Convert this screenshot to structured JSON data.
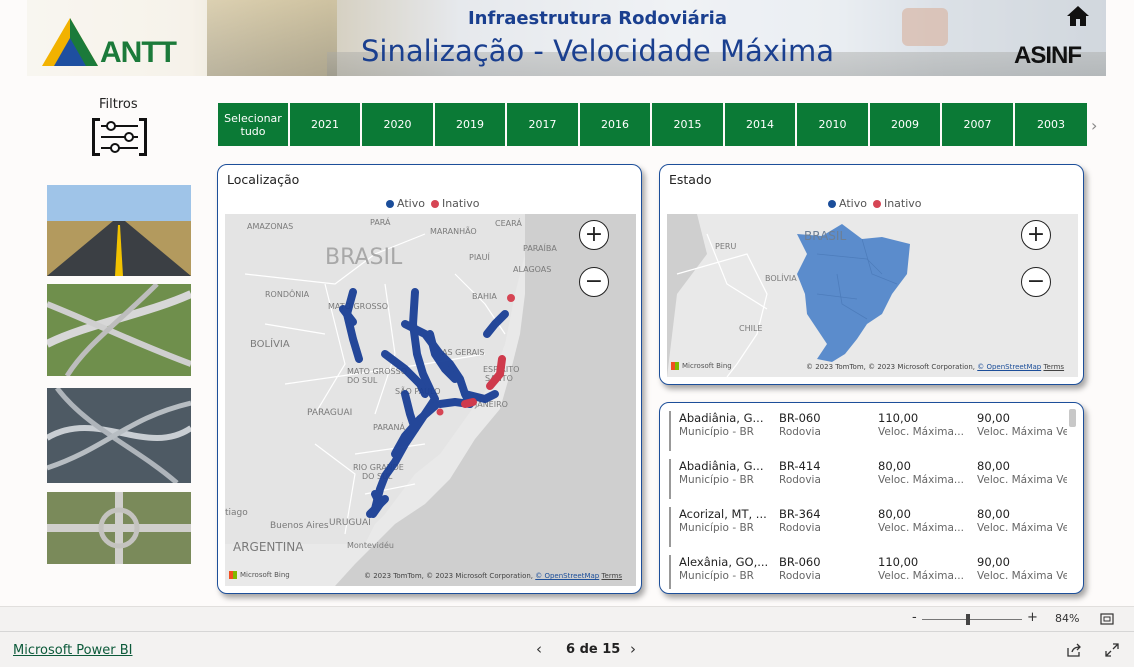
{
  "header": {
    "subtitle": "Infraestrutura Rodoviária",
    "title": "Sinalização - Velocidade Máxima",
    "logo_left": "ANTT",
    "logo_right": "ASINF"
  },
  "filters": {
    "label": "Filtros"
  },
  "years": [
    "Selecionar tudo",
    "2021",
    "2020",
    "2019",
    "2017",
    "2016",
    "2015",
    "2014",
    "2010",
    "2009",
    "2007",
    "2003"
  ],
  "location_card": {
    "title": "Localização",
    "legend": [
      {
        "label": "Ativo",
        "color": "#1b4d9a"
      },
      {
        "label": "Inativo",
        "color": "#d64554"
      }
    ],
    "map_labels": {
      "amazonas": "AMAZONAS",
      "para": "PARÁ",
      "maranhao": "MARANHÃO",
      "ceara": "CEARÁ",
      "paraiba": "PARAÍBA",
      "piaui": "PIAUÍ",
      "alagoas": "ALAGOAS",
      "brasil": "BRASIL",
      "rondonia": "RONDÔNIA",
      "bahia": "BAHIA",
      "mato_grosso": "MATO GROSSO",
      "bolivia": "BOLÍVIA",
      "minas": "AS GERAIS",
      "ms1": "MATO GROSSO",
      "ms2": "DO SUL",
      "espirito1": "ESPÍRITO",
      "espirito2": "SANTO",
      "sao_paulo": "SÃO PAULO",
      "paraguai": "PARAGUAI",
      "janeiro": "JANEIRO",
      "parana": "PARANÁ",
      "rio_grande1": "RIO GRANDE",
      "rio_grande2": "DO SUL",
      "tiago": "tiago",
      "buenos": "Buenos Aires",
      "uruguai": "URUGUAI",
      "argentina": "ARGENTINA",
      "montevideu": "Montevidéu"
    },
    "bing": "Microsoft Bing",
    "credit": "© 2023 TomTom, © 2023 Microsoft Corporation,",
    "osm": "© OpenStreetMap",
    "terms": "Terms",
    "zoom_in": "+",
    "zoom_out": "−"
  },
  "state_card": {
    "title": "Estado",
    "legend": [
      {
        "label": "Ativo",
        "color": "#1b4d9a"
      },
      {
        "label": "Inativo",
        "color": "#d64554"
      }
    ],
    "map_labels": {
      "brasil": "BRASIL",
      "peru": "PERU",
      "bolivia": "BOLÍVIA",
      "chile": "CHILE"
    },
    "bing": "Microsoft Bing",
    "credit": "© 2023 TomTom, © 2023 Microsoft Corporation,",
    "osm": "© OpenStreetMap",
    "terms": "Terms",
    "zoom_in": "+",
    "zoom_out": "−",
    "region_color": "#5b8ccc"
  },
  "table": {
    "rows": [
      {
        "c1": "Abadiânia, G...",
        "c1l": "Município - BR",
        "c2": "BR-060",
        "c2l": "Rodovia",
        "c3": "110,00",
        "c3l": "Veloc. Máxima...",
        "c4": "90,00",
        "c4l": "Veloc. Máxima Veí..."
      },
      {
        "c1": "Abadiânia, G...",
        "c1l": "Município - BR",
        "c2": "BR-414",
        "c2l": "Rodovia",
        "c3": "80,00",
        "c3l": "Veloc. Máxima...",
        "c4": "80,00",
        "c4l": "Veloc. Máxima Veí..."
      },
      {
        "c1": "Acorizal, MT, ...",
        "c1l": "Município - BR",
        "c2": "BR-364",
        "c2l": "Rodovia",
        "c3": "80,00",
        "c3l": "Veloc. Máxima...",
        "c4": "80,00",
        "c4l": "Veloc. Máxima Veí..."
      },
      {
        "c1": "Alexânia, GO,...",
        "c1l": "Município - BR",
        "c2": "BR-060",
        "c2l": "Rodovia",
        "c3": "110,00",
        "c3l": "Veloc. Máxima...",
        "c4": "90,00",
        "c4l": "Veloc. Máxima Veí..."
      }
    ]
  },
  "zoombar": {
    "minus": "-",
    "plus": "+",
    "zoom": "84%",
    "level": 0.46
  },
  "footer": {
    "link": "Microsoft Power BI",
    "page": "6 de 15"
  }
}
